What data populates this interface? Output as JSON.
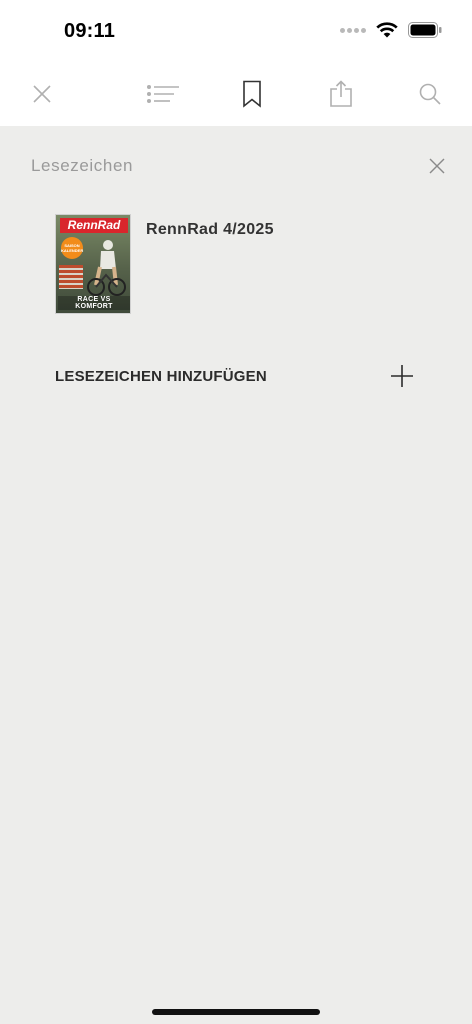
{
  "status_bar": {
    "time": "09:11"
  },
  "toolbar": {
    "icons": [
      "close-icon",
      "list-icon",
      "bookmark-icon",
      "share-icon",
      "search-icon"
    ],
    "active_color": "#333333",
    "inactive_color": "#b0b0b0"
  },
  "panel": {
    "title": "Lesezeichen"
  },
  "bookmarks": [
    {
      "title": "RennRad 4/2025",
      "cover": {
        "logo": "RennRad",
        "badge": "SAISON KALENDER",
        "tagline": "RACE VS KOMFORT"
      }
    }
  ],
  "add_bookmark": {
    "label": "LESEZEICHEN HINZUFÜGEN"
  },
  "colors": {
    "background": "#ededeb",
    "bar_background": "#ffffff",
    "brand_red": "#d9262c"
  }
}
